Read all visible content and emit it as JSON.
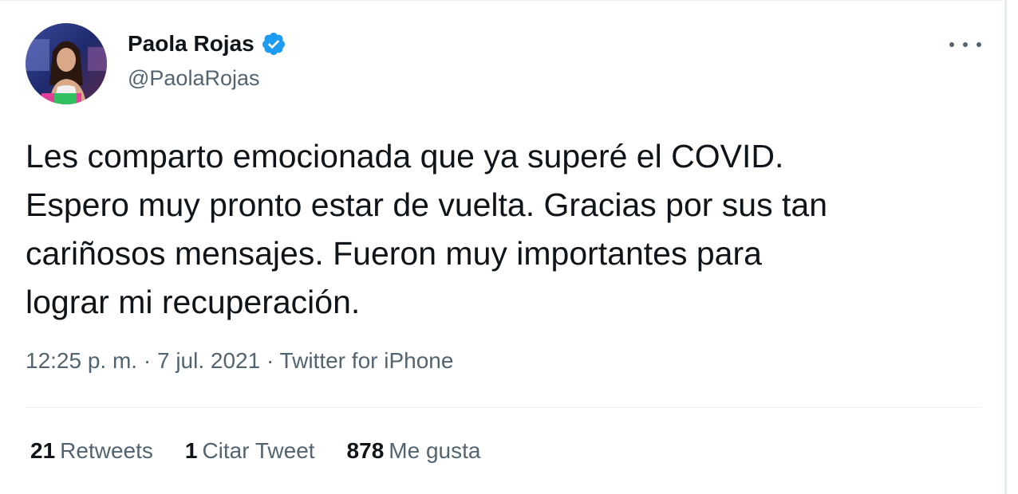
{
  "author": {
    "name": "Paola Rojas",
    "handle": "@PaolaRojas",
    "verified": true
  },
  "icons": {
    "verified": "verified-badge-icon",
    "more": "more-options-icon"
  },
  "tweet": {
    "lines": [
      "Les comparto emocionada que ya superé el COVID.",
      "Espero muy pronto estar de vuelta. Gracias por sus tan",
      "cariñosos mensajes. Fueron muy importantes para",
      "lograr mi recuperación."
    ],
    "meta": "12:25 p. m. · 7 jul. 2021 · Twitter for iPhone"
  },
  "stats": {
    "retweets_count": "21",
    "retweets_label": "Retweets",
    "quotes_count": "1",
    "quotes_label": "Citar Tweet",
    "likes_count": "878",
    "likes_label": "Me gusta"
  },
  "colors": {
    "verified_blue": "#1d9bf0",
    "text_primary": "#0f1419",
    "text_secondary": "#536471"
  }
}
